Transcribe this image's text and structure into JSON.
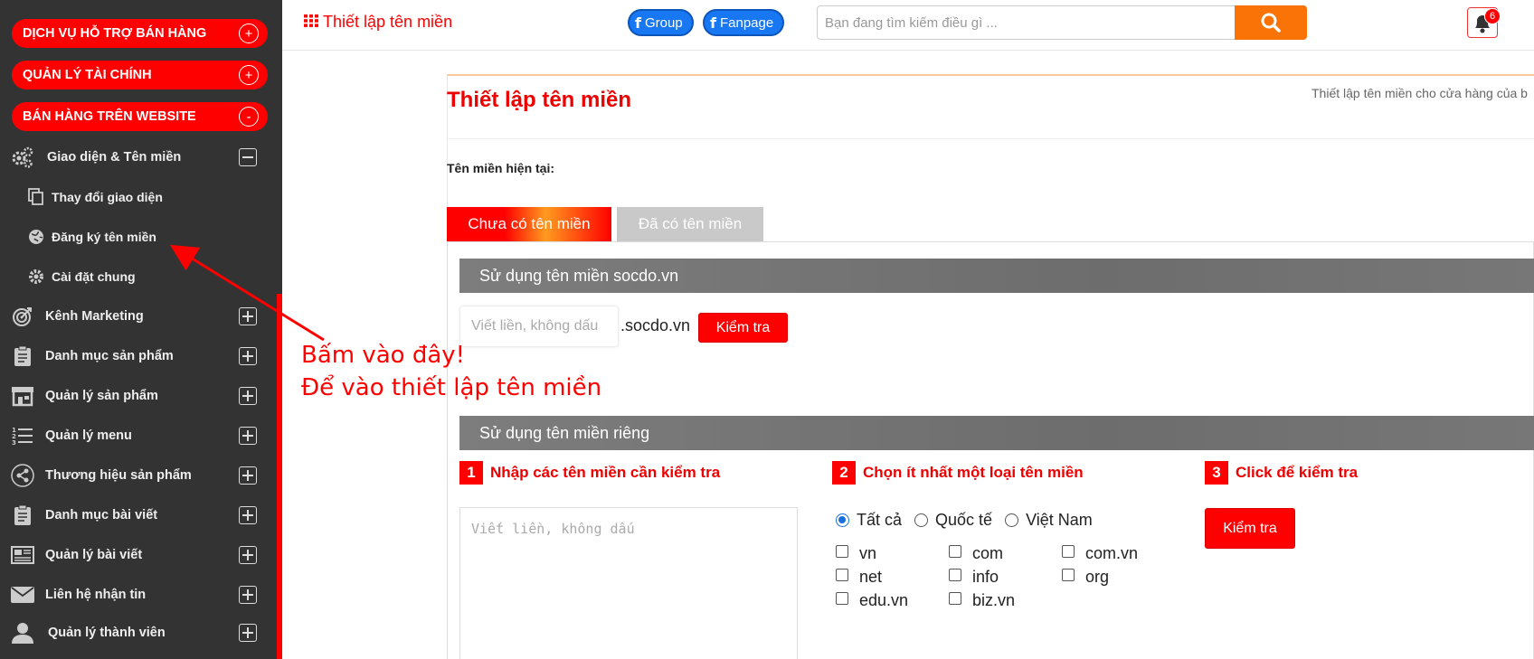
{
  "sidebar": {
    "pills": [
      {
        "label": "DỊCH VỤ HỖ TRỢ BÁN HÀNG",
        "toggle": "+"
      },
      {
        "label": "QUẢN LÝ TÀI CHÍNH",
        "toggle": "+"
      },
      {
        "label": "BÁN HÀNG TRÊN WEBSITE",
        "toggle": "-"
      }
    ],
    "group_open": "Giao diện & Tên miền",
    "sub_items": [
      "Thay đổi giao diện",
      "Đăng ký tên miền",
      "Cài đặt chung"
    ],
    "items": [
      "Kênh Marketing",
      "Danh mục sản phẩm",
      "Quản lý sản phẩm",
      "Quản lý menu",
      "Thương hiệu sản phẩm",
      "Danh mục bài viết",
      "Quản lý bài viết",
      "Liên hệ nhận tin",
      "Quản lý thành viên"
    ]
  },
  "topbar": {
    "title": "Thiết lập tên miền",
    "group_label": "Group",
    "fanpage_label": "Fanpage",
    "search_placeholder": "Bạn đang tìm kiếm điều gì ...",
    "notification_count": "6"
  },
  "main": {
    "heading": "Thiết lập tên miền",
    "subtitle": "Thiết lập tên miền cho cửa hàng của b",
    "current_domain_label": "Tên miền hiện tại:",
    "tabs": [
      "Chưa có tên miền",
      "Đã có tên miền"
    ],
    "socdo_section": {
      "title": "Sử dụng tên miền socdo.vn",
      "input_placeholder": "Viết liền, không dấu",
      "suffix": ".socdo.vn",
      "button": "Kiểm tra"
    },
    "own_section": {
      "title": "Sử dụng tên miền riêng",
      "steps": [
        {
          "num": "1",
          "label": "Nhập các tên miền cần kiểm tra"
        },
        {
          "num": "2",
          "label": "Chọn ít nhất một loại tên miền"
        },
        {
          "num": "3",
          "label": "Click để kiểm tra"
        }
      ],
      "textarea_placeholder": "Viết liền, không dấu",
      "radios": [
        "Tất cả",
        "Quốc tế",
        "Việt Nam"
      ],
      "checkboxes": [
        "vn",
        "com",
        "com.vn",
        "net",
        "info",
        "org",
        "edu.vn",
        "biz.vn"
      ],
      "button": "Kiểm tra"
    }
  },
  "annotation": {
    "line1": "Bấm vào đây!",
    "line2": "Để vào thiết lập tên miền",
    "color": "#ff0000"
  }
}
